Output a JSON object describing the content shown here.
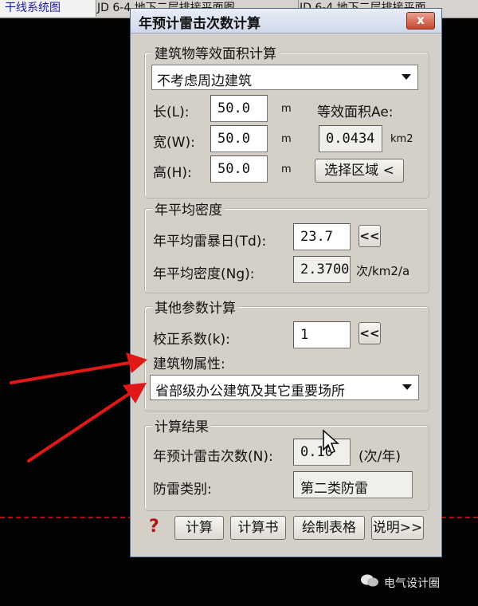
{
  "tabs": [
    "干线系统图",
    "JD 6-4 地下二层排接平面图",
    "JD 6-4 地下二层排接平面"
  ],
  "dialog": {
    "title": "年预计雷击次数计算",
    "close_label": "x",
    "group1": {
      "label": "建筑物等效面积计算",
      "select_value": "不考虑周边建筑",
      "length_label": "长(L):",
      "length_value": "50.0",
      "width_label": "宽(W):",
      "width_value": "50.0",
      "height_label": "高(H):",
      "height_value": "50.0",
      "unit_m": "m",
      "area_label": "等效面积Ae:",
      "area_value": "0.0434",
      "area_unit": "km2",
      "select_area_button": "选择区域 <"
    },
    "group2": {
      "label": "年平均密度",
      "td_label": "年平均雷暴日(Td):",
      "td_value": "23.7",
      "ng_label": "年平均密度(Ng):",
      "ng_value": "2.3700",
      "ng_unit": "次/km2/a",
      "pick_button": "<<"
    },
    "group3": {
      "label": "其他参数计算",
      "k_label": "校正系数(k):",
      "k_value": "1",
      "pick_button": "<<",
      "property_label": "建筑物属性:",
      "property_value": "省部级办公建筑及其它重要场所"
    },
    "group4": {
      "label": "计算结果",
      "n_label": "年预计雷击次数(N):",
      "n_value": "0.10",
      "n_unit": "(次/年)",
      "class_label": "防雷类别:",
      "class_value": "第二类防雷"
    },
    "footer": {
      "help": "?",
      "calc_button": "计算",
      "report_button": "计算书",
      "table_button": "绘制表格",
      "explain_button": "说明>>"
    }
  },
  "watermark": "电气设计圈",
  "colors": {
    "arrow": "#e01818",
    "dash_line": "#b01010"
  }
}
